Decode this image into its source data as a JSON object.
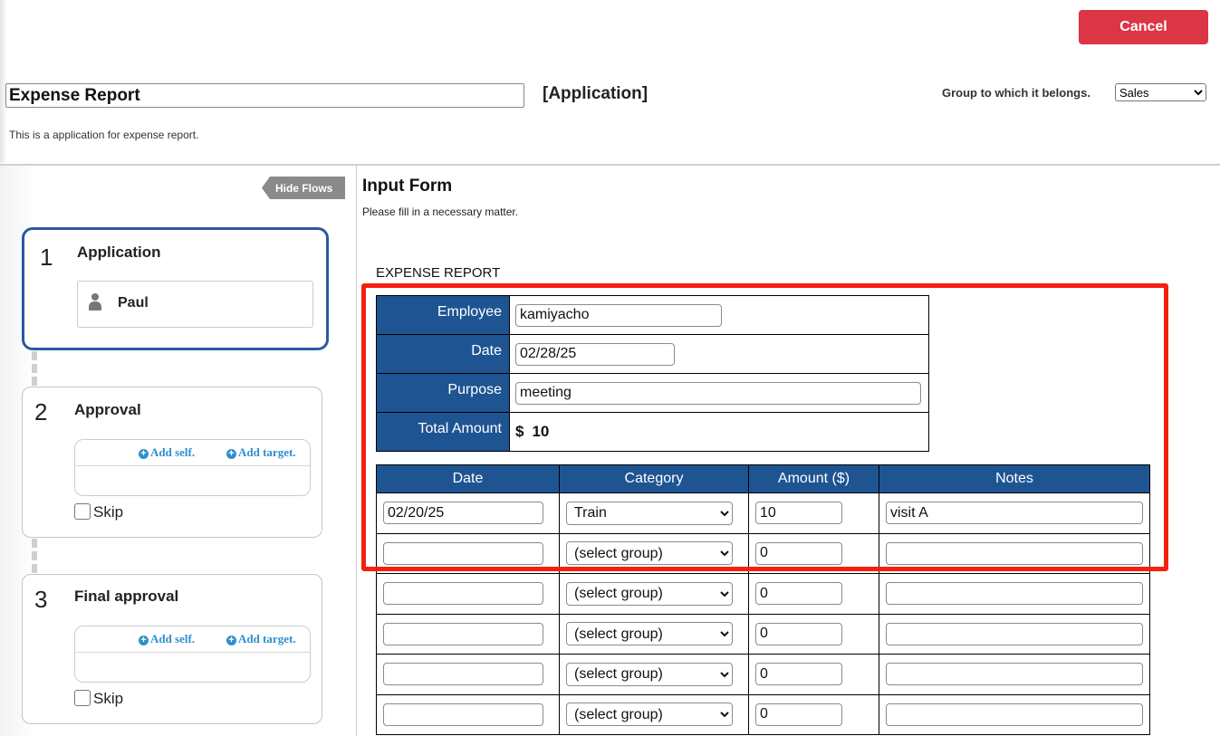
{
  "header": {
    "cancel_label": "Cancel",
    "title_value": "Expense Report",
    "app_tag": "[Application]",
    "group_label": "Group to which it belongs.",
    "group_selected": "Sales",
    "description": "This is a application for expense report."
  },
  "flow": {
    "hide_label": "Hide Flows",
    "steps": [
      {
        "number": "1",
        "title": "Application",
        "user": "Paul"
      },
      {
        "number": "2",
        "title": "Approval",
        "add_self": "Add self.",
        "add_target": "Add target.",
        "skip": "Skip"
      },
      {
        "number": "3",
        "title": "Final approval",
        "add_self": "Add self.",
        "add_target": "Add target.",
        "skip": "Skip"
      }
    ]
  },
  "form": {
    "heading": "Input Form",
    "subheading": "Please fill in a necessary matter.",
    "report_title": "EXPENSE REPORT",
    "fields": {
      "employee_label": "Employee",
      "employee_value": "kamiyacho",
      "date_label": "Date",
      "date_value": "02/28/25",
      "purpose_label": "Purpose",
      "purpose_value": "meeting",
      "total_label": "Total Amount",
      "total_currency": "$",
      "total_value": "10"
    },
    "columns": [
      "Date",
      "Category",
      "Amount ($)",
      "Notes"
    ],
    "rows": [
      {
        "date": "02/20/25",
        "category": "Train",
        "amount": "10",
        "notes": "visit A"
      },
      {
        "date": "",
        "category": "(select group)",
        "amount": "0",
        "notes": ""
      },
      {
        "date": "",
        "category": "(select group)",
        "amount": "0",
        "notes": ""
      },
      {
        "date": "",
        "category": "(select group)",
        "amount": "0",
        "notes": ""
      },
      {
        "date": "",
        "category": "(select group)",
        "amount": "0",
        "notes": ""
      },
      {
        "date": "",
        "category": "(select group)",
        "amount": "0",
        "notes": ""
      }
    ]
  },
  "colors": {
    "accent_blue": "#1f5493",
    "cancel_red": "#dc3545",
    "highlight_red": "#f4210f",
    "active_step_border": "#2c5aa0",
    "link_blue": "#2f8fcc"
  }
}
